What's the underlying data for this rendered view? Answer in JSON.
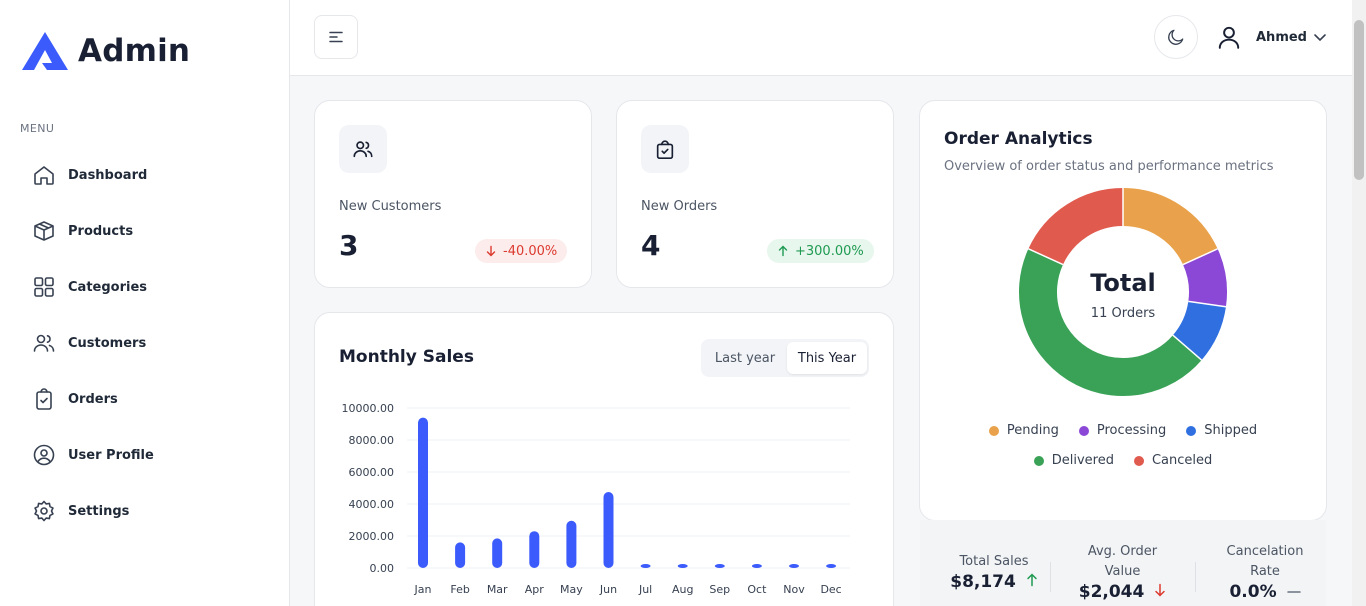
{
  "app": {
    "brand": "Admin"
  },
  "sidebar": {
    "section_label": "MENU",
    "items": [
      {
        "label": "Dashboard",
        "icon": "home-icon"
      },
      {
        "label": "Products",
        "icon": "box-icon"
      },
      {
        "label": "Categories",
        "icon": "grid-icon"
      },
      {
        "label": "Customers",
        "icon": "users-icon"
      },
      {
        "label": "Orders",
        "icon": "clipboard-icon"
      },
      {
        "label": "User Profile",
        "icon": "user-circle-icon"
      },
      {
        "label": "Settings",
        "icon": "gear-icon"
      }
    ]
  },
  "header": {
    "user_name": "Ahmed"
  },
  "stats": {
    "customers": {
      "label": "New Customers",
      "value": "3",
      "change": "-40.00%",
      "trend": "down"
    },
    "orders": {
      "label": "New Orders",
      "value": "4",
      "change": "+300.00%",
      "trend": "up"
    }
  },
  "monthly_sales": {
    "title": "Monthly Sales",
    "toggle": {
      "last_year": "Last year",
      "this_year": "This Year",
      "selected": "This Year"
    }
  },
  "order_analytics": {
    "title": "Order Analytics",
    "subtitle": "Overview of order status and performance metrics",
    "center_title": "Total",
    "center_subtitle": "11 Orders",
    "legend": [
      {
        "label": "Pending",
        "color": "#e9a24b"
      },
      {
        "label": "Processing",
        "color": "#8b48d6"
      },
      {
        "label": "Shipped",
        "color": "#2f6fe0"
      },
      {
        "label": "Delivered",
        "color": "#3aa257"
      },
      {
        "label": "Canceled",
        "color": "#e05a4e"
      }
    ]
  },
  "metrics": [
    {
      "label": "Total Sales",
      "value": "$8,174",
      "trend": "up"
    },
    {
      "label": "Avg. Order Value",
      "value": "$2,044",
      "trend": "down"
    },
    {
      "label": "Cancelation Rate",
      "value": "0.0%",
      "trend": "flat"
    }
  ],
  "colors": {
    "accent": "#3b5bfd",
    "up": "#1e9a51",
    "down": "#dc3a2f"
  },
  "chart_data": [
    {
      "type": "bar",
      "title": "Monthly Sales",
      "categories": [
        "Jan",
        "Feb",
        "Mar",
        "Apr",
        "May",
        "Jun",
        "Jul",
        "Aug",
        "Sep",
        "Oct",
        "Nov",
        "Dec"
      ],
      "values": [
        9400,
        1600,
        1850,
        2300,
        2950,
        4750,
        0,
        0,
        0,
        0,
        0,
        0
      ],
      "yticks": [
        "0.00",
        "2000.00",
        "4000.00",
        "6000.00",
        "8000.00",
        "10000.00"
      ],
      "ylim": [
        0,
        10000
      ],
      "grid": true,
      "color": "#3b5bfd"
    },
    {
      "type": "pie",
      "title": "Order Analytics",
      "categories": [
        "Pending",
        "Processing",
        "Shipped",
        "Delivered",
        "Canceled"
      ],
      "values": [
        2,
        1,
        1,
        5,
        2
      ],
      "colors": [
        "#e9a24b",
        "#8b48d6",
        "#2f6fe0",
        "#3aa257",
        "#e05a4e"
      ],
      "center_label": "Total",
      "center_sublabel": "11 Orders"
    }
  ]
}
